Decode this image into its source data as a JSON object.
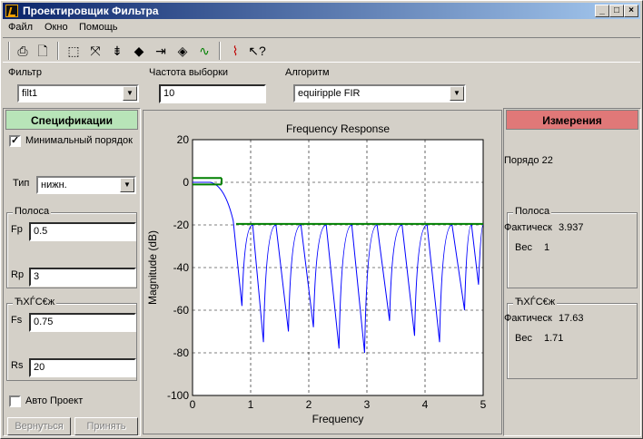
{
  "window": {
    "title": "Проектировщик Фильтра",
    "minimize": "_",
    "maximize": "□",
    "close": "×"
  },
  "menu": [
    "Файл",
    "Окно",
    "Помощь"
  ],
  "toolbar_icons": [
    "print-icon",
    "print-preview-icon",
    "zoom-box-icon",
    "zoom-fit-icon",
    "zoom-vertical-icon",
    "zoom-expand-icon",
    "zoom-horizontal-icon",
    "pan-icon",
    "view-response-icon",
    "filter-response-icon",
    "whats-this-icon"
  ],
  "top": {
    "filter_label": "Фильтр",
    "filter_value": "filt1",
    "fs_label": "Частота выборки",
    "fs_value": "10",
    "algo_label": "Алгоритм",
    "algo_value": "equiripple FIR"
  },
  "spec": {
    "header": "Спецификации",
    "min_order_label": "Минимальный порядок",
    "min_order_checked": true,
    "type_label": "Тип",
    "type_value": "нижн.",
    "passband_title": "Полоса",
    "fp_label": "Fp",
    "fp_value": "0.5",
    "rp_label": "Rp",
    "rp_value": "3",
    "stopband_title": "ЋХЃС€ж",
    "fs_label": "Fs",
    "fs_value": "0.75",
    "rs_label": "Rs",
    "rs_value": "20",
    "auto_label": "Авто Проект",
    "revert_label": "Вернуться",
    "apply_label": "Принять"
  },
  "measure": {
    "header": "Измерения",
    "order_label": "Порядо",
    "order_value": "22",
    "passband_title": "Полоса",
    "pb_actual_label": "Фактическ",
    "pb_actual_value": "3.937",
    "pb_weight_label": "Вес",
    "pb_weight_value": "1",
    "stopband_title": "ЋХЃС€ж",
    "sb_actual_label": "Фактическ",
    "sb_actual_value": "17.63",
    "sb_weight_label": "Вес",
    "sb_weight_value": "1.71"
  },
  "colors": {
    "spec_header": "#b8e4b8",
    "measure_header": "#e07878",
    "response": "#0000ff",
    "spec_line": "#008000"
  },
  "chart_data": {
    "type": "line",
    "title": "Frequency Response",
    "xlabel": "Frequency",
    "ylabel": "Magnitude (dB)",
    "xlim": [
      0,
      5
    ],
    "ylim": [
      -100,
      20
    ],
    "xticks": [
      0,
      1,
      2,
      3,
      4,
      5
    ],
    "yticks": [
      20,
      0,
      -20,
      -40,
      -60,
      -80,
      -100
    ],
    "grid": true,
    "series": [
      {
        "values_note": "equiripple lowpass response",
        "nulls": [
          0.85,
          1.22,
          1.65,
          2.08,
          2.52,
          2.96,
          3.39,
          3.82,
          4.25,
          4.68,
          4.92
        ],
        "null_depths": [
          -58,
          -75,
          -70,
          -68,
          -78,
          -80,
          -65,
          -72,
          -75,
          -60,
          -48
        ],
        "ripple_peak": -20
      }
    ],
    "spec_lines": {
      "passband": [
        [
          0,
          0.5,
          2
        ],
        [
          0,
          0.5,
          -1
        ]
      ],
      "stopband": [
        0.75,
        5,
        -19.5
      ]
    }
  }
}
